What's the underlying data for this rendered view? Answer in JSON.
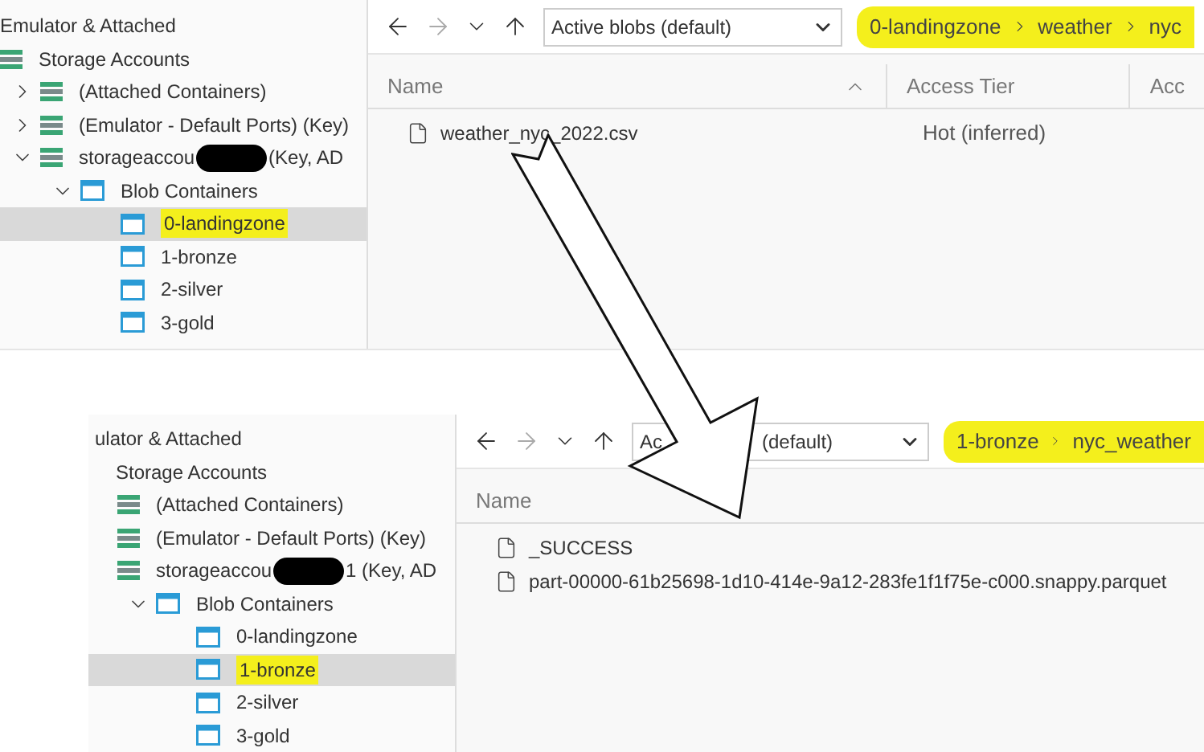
{
  "top": {
    "tree": [
      {
        "label": "Emulator & Attached",
        "kind": "header",
        "children": [
          {
            "label": "Storage Accounts",
            "kind": "account",
            "children": [
              {
                "label": "(Attached Containers)",
                "kind": "account",
                "expanded": false
              },
              {
                "label": "(Emulator - Default Ports) (Key)",
                "kind": "account",
                "expanded": false
              },
              {
                "label": "storageaccou",
                "label_after": "(Key, AD",
                "redacted": true,
                "kind": "account",
                "expanded": true,
                "children": [
                  {
                    "label": "Blob Containers",
                    "kind": "container",
                    "expanded": true,
                    "children": [
                      {
                        "label": "0-landingzone",
                        "kind": "container",
                        "selected": true,
                        "highlighted": true
                      },
                      {
                        "label": "1-bronze",
                        "kind": "container",
                        "selected": false,
                        "highlighted": false
                      },
                      {
                        "label": "2-silver",
                        "kind": "container",
                        "selected": false,
                        "highlighted": false
                      },
                      {
                        "label": "3-gold",
                        "kind": "container",
                        "selected": false,
                        "highlighted": false
                      }
                    ]
                  }
                ]
              }
            ]
          }
        ]
      }
    ],
    "filter": {
      "parts": [
        "Active blobs (default)"
      ]
    },
    "breadcrumb": {
      "highlighted": true,
      "parts": [
        "0-landingzone",
        "weather",
        "nyc"
      ]
    },
    "columns": [
      {
        "label": "Name",
        "sorted": true
      },
      {
        "label": "Access Tier",
        "sorted": false
      },
      {
        "label": "Acc",
        "sorted": false
      }
    ],
    "rows": [
      {
        "cells": [
          "weather_nyc_2022.csv",
          "Hot (inferred)"
        ]
      }
    ]
  },
  "bottom": {
    "tree": [
      {
        "label": "ulator & Attached",
        "kind": "header",
        "children": [
          {
            "label": "Storage Accounts",
            "children": [
              {
                "label": "(Attached Containers)",
                "kind": "account"
              },
              {
                "label": "(Emulator - Default Ports) (Key)",
                "kind": "account"
              },
              {
                "label": "storageaccou",
                "label_after": "1 (Key, AD",
                "redacted": true,
                "kind": "account",
                "children": [
                  {
                    "label": "Blob Containers",
                    "kind": "container",
                    "expanded": true,
                    "children": [
                      {
                        "label": "0-landingzone",
                        "kind": "container",
                        "selected": false,
                        "highlighted": false
                      },
                      {
                        "label": "1-bronze",
                        "kind": "container",
                        "selected": true,
                        "highlighted": true
                      },
                      {
                        "label": "2-silver",
                        "kind": "container",
                        "selected": false,
                        "highlighted": false
                      },
                      {
                        "label": "3-gold",
                        "kind": "container",
                        "selected": false,
                        "highlighted": false
                      }
                    ]
                  }
                ]
              }
            ]
          }
        ]
      }
    ],
    "filter": {
      "parts": [
        "Ac",
        "(default)"
      ]
    },
    "breadcrumb": {
      "highlighted": true,
      "parts": [
        "1-bronze",
        "nyc_weather"
      ]
    },
    "columns": [
      {
        "label": "Name",
        "sorted": false
      }
    ],
    "rows": [
      {
        "cells": [
          "_SUCCESS"
        ]
      },
      {
        "cells": [
          "part-00000-61b25698-1d10-414e-9a12-283fe1f1f75e-c000.snappy.parquet"
        ]
      }
    ]
  }
}
